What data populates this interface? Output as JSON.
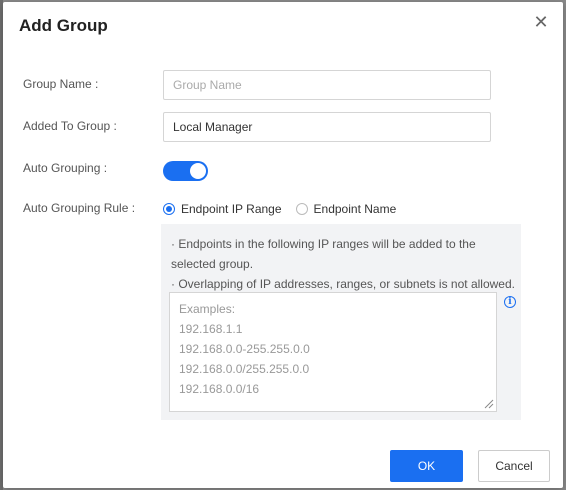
{
  "dialog": {
    "title": "Add Group",
    "close_icon": "close-icon"
  },
  "fields": {
    "group_name": {
      "label": "Group Name :",
      "placeholder": "Group Name",
      "value": ""
    },
    "added_to_group": {
      "label": "Added To Group :",
      "value": "Local Manager"
    },
    "auto_grouping": {
      "label": "Auto Grouping :",
      "enabled": true
    },
    "auto_grouping_rule": {
      "label": "Auto Grouping Rule :",
      "options": [
        {
          "label": "Endpoint IP Range",
          "selected": true
        },
        {
          "label": "Endpoint Name",
          "selected": false
        }
      ]
    }
  },
  "rule_panel": {
    "note_1": "· Endpoints in the following IP ranges will be added to the selected group.",
    "note_2": "· Overlapping of IP addresses, ranges, or subnets is not allowed.",
    "examples": [
      "Examples:",
      "192.168.1.1",
      "192.168.0.0-255.255.0.0",
      "192.168.0.0/255.255.0.0",
      "192.168.0.0/16"
    ],
    "info_icon": "info-icon"
  },
  "footer": {
    "ok_label": "OK",
    "cancel_label": "Cancel"
  },
  "colors": {
    "accent": "#1a6ff1",
    "panel_bg": "#f2f3f5",
    "backdrop": "#8a8a8a"
  }
}
